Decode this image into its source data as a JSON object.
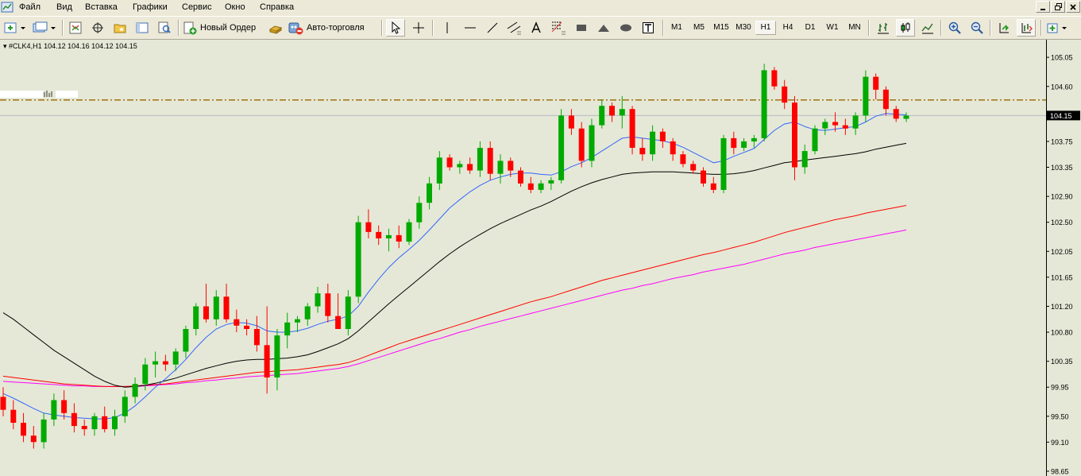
{
  "menu": [
    "Файл",
    "Вид",
    "Вставка",
    "Графики",
    "Сервис",
    "Окно",
    "Справка"
  ],
  "window_controls": [
    "minimize",
    "restore",
    "close"
  ],
  "toolbar": {
    "new_order_label": "Новый Ордер",
    "autotrading_label": "Авто-торговля",
    "timeframes": [
      "M1",
      "M5",
      "M15",
      "M30",
      "H1",
      "H4",
      "D1",
      "W1",
      "MN"
    ],
    "active_timeframe": "H1"
  },
  "chart_header": {
    "symbol": "#CLK4,H1",
    "ohlc": "104.12 104.16 104.12 104.15"
  },
  "price_axis": {
    "labels": [
      "105.05",
      "104.60",
      "104.15",
      "103.75",
      "103.35",
      "102.90",
      "102.50",
      "102.05",
      "101.65",
      "101.20",
      "100.80",
      "100.35",
      "99.95",
      "99.50",
      "99.10",
      "98.65"
    ],
    "current_price": "104.15"
  },
  "colors": {
    "bull_candle": "#00aa00",
    "bear_candle": "#ff0000",
    "ma_fast": "#3366ff",
    "ma_medium": "#000000",
    "ma_slow": "#ff0000",
    "ma_slowest": "#ff00ff",
    "level_line": "#996600",
    "chart_bg": "#e5e8d6"
  },
  "chart_data": {
    "type": "candlestick",
    "symbol": "#CLK4",
    "timeframe": "H1",
    "ylim": [
      98.65,
      105.15
    ],
    "level_line": 104.39,
    "candles": [
      [
        99.8,
        99.95,
        99.5,
        99.6
      ],
      [
        99.6,
        99.75,
        99.3,
        99.4
      ],
      [
        99.4,
        99.55,
        99.1,
        99.2
      ],
      [
        99.2,
        99.35,
        99.0,
        99.1
      ],
      [
        99.1,
        99.55,
        99.0,
        99.45
      ],
      [
        99.45,
        99.85,
        99.35,
        99.75
      ],
      [
        99.75,
        99.9,
        99.45,
        99.55
      ],
      [
        99.55,
        99.7,
        99.25,
        99.35
      ],
      [
        99.35,
        99.45,
        99.2,
        99.3
      ],
      [
        99.3,
        99.55,
        99.2,
        99.5
      ],
      [
        99.5,
        99.65,
        99.25,
        99.3
      ],
      [
        99.3,
        99.6,
        99.2,
        99.5
      ],
      [
        99.5,
        99.9,
        99.4,
        99.8
      ],
      [
        99.8,
        100.1,
        99.7,
        100.0
      ],
      [
        100.0,
        100.4,
        99.9,
        100.3
      ],
      [
        100.3,
        100.5,
        100.1,
        100.35
      ],
      [
        100.35,
        100.45,
        100.2,
        100.3
      ],
      [
        100.3,
        100.55,
        100.2,
        100.5
      ],
      [
        100.5,
        100.9,
        100.4,
        100.85
      ],
      [
        100.85,
        101.25,
        100.75,
        101.2
      ],
      [
        101.2,
        101.55,
        100.95,
        101.0
      ],
      [
        101.0,
        101.45,
        100.9,
        101.35
      ],
      [
        101.35,
        101.55,
        100.95,
        101.0
      ],
      [
        101.0,
        101.15,
        100.8,
        100.9
      ],
      [
        100.9,
        101.0,
        100.75,
        100.85
      ],
      [
        100.85,
        101.05,
        100.5,
        100.6
      ],
      [
        100.6,
        101.2,
        99.85,
        100.1
      ],
      [
        100.1,
        100.85,
        99.9,
        100.75
      ],
      [
        100.75,
        101.1,
        100.55,
        100.95
      ],
      [
        100.95,
        101.05,
        100.8,
        101.0
      ],
      [
        101.0,
        101.25,
        100.9,
        101.2
      ],
      [
        101.2,
        101.5,
        101.1,
        101.4
      ],
      [
        101.4,
        101.55,
        100.95,
        101.05
      ],
      [
        101.05,
        101.4,
        100.95,
        100.85
      ],
      [
        100.85,
        101.45,
        100.75,
        101.35
      ],
      [
        101.35,
        102.6,
        101.25,
        102.5
      ],
      [
        102.5,
        102.7,
        102.25,
        102.35
      ],
      [
        102.35,
        102.45,
        102.15,
        102.25
      ],
      [
        102.25,
        102.4,
        102.05,
        102.3
      ],
      [
        102.3,
        102.45,
        102.1,
        102.2
      ],
      [
        102.2,
        102.55,
        102.15,
        102.5
      ],
      [
        102.5,
        102.9,
        102.4,
        102.8
      ],
      [
        102.8,
        103.2,
        102.7,
        103.1
      ],
      [
        103.1,
        103.6,
        103.0,
        103.5
      ],
      [
        103.5,
        103.55,
        103.3,
        103.35
      ],
      [
        103.35,
        103.45,
        103.25,
        103.4
      ],
      [
        103.4,
        103.5,
        103.25,
        103.3
      ],
      [
        103.3,
        103.75,
        103.2,
        103.65
      ],
      [
        103.65,
        103.75,
        103.15,
        103.25
      ],
      [
        103.25,
        103.55,
        103.1,
        103.45
      ],
      [
        103.45,
        103.5,
        103.2,
        103.3
      ],
      [
        103.3,
        103.35,
        103.05,
        103.1
      ],
      [
        103.1,
        103.2,
        102.95,
        103.0
      ],
      [
        103.0,
        103.15,
        102.95,
        103.1
      ],
      [
        103.1,
        103.2,
        103.0,
        103.15
      ],
      [
        103.15,
        104.25,
        103.1,
        104.15
      ],
      [
        104.15,
        104.25,
        103.85,
        103.95
      ],
      [
        103.95,
        104.05,
        103.35,
        103.45
      ],
      [
        103.45,
        104.1,
        103.35,
        104.0
      ],
      [
        104.0,
        104.4,
        103.95,
        104.3
      ],
      [
        104.3,
        104.35,
        104.05,
        104.15
      ],
      [
        104.15,
        104.45,
        103.95,
        104.25
      ],
      [
        104.25,
        104.3,
        103.55,
        103.65
      ],
      [
        103.65,
        103.8,
        103.45,
        103.55
      ],
      [
        103.55,
        104.0,
        103.45,
        103.9
      ],
      [
        103.9,
        103.95,
        103.65,
        103.75
      ],
      [
        103.75,
        103.8,
        103.45,
        103.55
      ],
      [
        103.55,
        103.6,
        103.35,
        103.4
      ],
      [
        103.4,
        103.45,
        103.25,
        103.3
      ],
      [
        103.3,
        103.35,
        103.05,
        103.1
      ],
      [
        103.1,
        103.2,
        102.95,
        103.0
      ],
      [
        103.0,
        103.85,
        102.95,
        103.8
      ],
      [
        103.8,
        103.9,
        103.55,
        103.65
      ],
      [
        103.65,
        103.8,
        103.6,
        103.75
      ],
      [
        103.75,
        103.85,
        103.65,
        103.8
      ],
      [
        103.8,
        104.95,
        103.75,
        104.85
      ],
      [
        104.85,
        104.9,
        104.55,
        104.6
      ],
      [
        104.6,
        104.7,
        104.25,
        104.35
      ],
      [
        104.35,
        104.45,
        103.15,
        103.35
      ],
      [
        103.35,
        103.7,
        103.25,
        103.6
      ],
      [
        103.6,
        104.0,
        103.55,
        103.95
      ],
      [
        103.95,
        104.1,
        103.85,
        104.05
      ],
      [
        104.05,
        104.2,
        103.9,
        104.0
      ],
      [
        104.0,
        104.1,
        103.85,
        103.95
      ],
      [
        103.95,
        104.2,
        103.85,
        104.15
      ],
      [
        104.15,
        104.85,
        104.05,
        104.75
      ],
      [
        104.75,
        104.8,
        104.4,
        104.55
      ],
      [
        104.55,
        104.6,
        104.15,
        104.25
      ],
      [
        104.25,
        104.3,
        104.05,
        104.1
      ],
      [
        104.1,
        104.2,
        104.05,
        104.15
      ]
    ],
    "ma_fast": [
      99.85,
      99.78,
      99.7,
      99.62,
      99.55,
      99.52,
      99.5,
      99.48,
      99.47,
      99.46,
      99.46,
      99.48,
      99.55,
      99.66,
      99.8,
      99.95,
      100.08,
      100.22,
      100.38,
      100.56,
      100.72,
      100.85,
      100.92,
      100.95,
      100.94,
      100.9,
      100.82,
      100.8,
      100.8,
      100.82,
      100.86,
      100.92,
      100.97,
      101.0,
      101.05,
      101.2,
      101.42,
      101.62,
      101.8,
      101.95,
      102.08,
      102.22,
      102.38,
      102.55,
      102.72,
      102.85,
      102.97,
      103.07,
      103.15,
      103.2,
      103.24,
      103.26,
      103.26,
      103.24,
      103.23,
      103.28,
      103.36,
      103.42,
      103.5,
      103.6,
      103.7,
      103.8,
      103.82,
      103.8,
      103.78,
      103.76,
      103.72,
      103.66,
      103.58,
      103.5,
      103.42,
      103.45,
      103.52,
      103.58,
      103.64,
      103.78,
      103.92,
      104.02,
      104.05,
      103.98,
      103.93,
      103.92,
      103.94,
      103.96,
      103.98,
      104.05,
      104.14,
      104.18,
      104.17,
      104.16
    ],
    "ma_medium": [
      101.1,
      101.0,
      100.88,
      100.76,
      100.64,
      100.52,
      100.42,
      100.32,
      100.22,
      100.12,
      100.04,
      99.98,
      99.95,
      99.96,
      99.98,
      100.01,
      100.05,
      100.09,
      100.14,
      100.19,
      100.24,
      100.28,
      100.32,
      100.35,
      100.37,
      100.38,
      100.38,
      100.39,
      100.4,
      100.42,
      100.45,
      100.5,
      100.56,
      100.62,
      100.7,
      100.82,
      100.96,
      101.1,
      101.24,
      101.37,
      101.5,
      101.63,
      101.76,
      101.89,
      102.01,
      102.12,
      102.22,
      102.31,
      102.4,
      102.48,
      102.55,
      102.62,
      102.69,
      102.75,
      102.82,
      102.9,
      102.98,
      103.05,
      103.11,
      103.16,
      103.2,
      103.24,
      103.26,
      103.27,
      103.28,
      103.28,
      103.28,
      103.27,
      103.26,
      103.25,
      103.24,
      103.24,
      103.25,
      103.27,
      103.3,
      103.34,
      103.38,
      103.42,
      103.44,
      103.46,
      103.48,
      103.5,
      103.52,
      103.54,
      103.56,
      103.59,
      103.63,
      103.66,
      103.69,
      103.72
    ],
    "ma_slow": [
      100.12,
      100.1,
      100.08,
      100.06,
      100.04,
      100.02,
      100.0,
      99.99,
      99.98,
      99.97,
      99.96,
      99.96,
      99.96,
      99.97,
      99.98,
      99.99,
      100.0,
      100.02,
      100.04,
      100.06,
      100.08,
      100.1,
      100.12,
      100.14,
      100.16,
      100.18,
      100.19,
      100.2,
      100.21,
      100.22,
      100.24,
      100.26,
      100.28,
      100.3,
      100.33,
      100.38,
      100.44,
      100.5,
      100.56,
      100.62,
      100.67,
      100.72,
      100.77,
      100.82,
      100.87,
      100.92,
      100.97,
      101.02,
      101.07,
      101.12,
      101.17,
      101.22,
      101.27,
      101.31,
      101.35,
      101.4,
      101.45,
      101.5,
      101.55,
      101.6,
      101.64,
      101.68,
      101.72,
      101.76,
      101.8,
      101.84,
      101.88,
      101.92,
      101.96,
      102.0,
      102.03,
      102.07,
      102.11,
      102.15,
      102.19,
      102.24,
      102.29,
      102.34,
      102.38,
      102.42,
      102.46,
      102.5,
      102.54,
      102.57,
      102.6,
      102.64,
      102.67,
      102.7,
      102.73,
      102.76
    ],
    "ma_slowest": [
      100.04,
      100.03,
      100.02,
      100.01,
      100.0,
      99.99,
      99.98,
      99.97,
      99.97,
      99.96,
      99.96,
      99.96,
      99.96,
      99.96,
      99.97,
      99.98,
      99.99,
      100.0,
      100.02,
      100.03,
      100.05,
      100.06,
      100.08,
      100.09,
      100.11,
      100.12,
      100.13,
      100.14,
      100.15,
      100.16,
      100.18,
      100.2,
      100.22,
      100.24,
      100.27,
      100.31,
      100.36,
      100.41,
      100.46,
      100.51,
      100.56,
      100.61,
      100.66,
      100.7,
      100.75,
      100.8,
      100.84,
      100.89,
      100.93,
      100.97,
      101.01,
      101.05,
      101.09,
      101.13,
      101.17,
      101.21,
      101.25,
      101.29,
      101.33,
      101.37,
      101.41,
      101.45,
      101.48,
      101.52,
      101.55,
      101.59,
      101.63,
      101.66,
      101.69,
      101.73,
      101.76,
      101.79,
      101.82,
      101.85,
      101.89,
      101.93,
      101.97,
      102.01,
      102.04,
      102.07,
      102.11,
      102.14,
      102.17,
      102.2,
      102.23,
      102.26,
      102.29,
      102.32,
      102.35,
      102.38
    ]
  }
}
